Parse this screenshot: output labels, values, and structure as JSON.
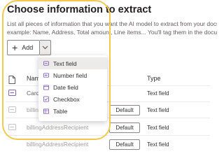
{
  "page": {
    "title": "Choose information to extract",
    "description_line1": "List all pieces of information that you want the AI model to extract from your documents. For",
    "description_line2": "example: Name, Address, Total amount, Line items... You'll tag them in the documents."
  },
  "toolbar": {
    "add_label": "Add",
    "add_icon": "plus-icon",
    "dropdown_icon": "chevron-down-icon"
  },
  "menu": {
    "items": [
      {
        "label": "Text field",
        "icon": "text-field-icon"
      },
      {
        "label": "Number field",
        "icon": "number-field-icon"
      },
      {
        "label": "Date field",
        "icon": "date-field-icon"
      },
      {
        "label": "Checkbox",
        "icon": "checkbox-icon"
      },
      {
        "label": "Table",
        "icon": "table-icon"
      }
    ],
    "selected_index": 0
  },
  "table": {
    "header_name": "Name",
    "header_type": "Type",
    "rows": [
      {
        "name": "CardHolder",
        "type": "Text field"
      },
      {
        "name": "billingAddressRecipient",
        "default_label": "Default",
        "type": "Text field"
      },
      {
        "name": "billingAddressRecipient",
        "default_label": "Default",
        "type": "Text field"
      },
      {
        "name": "billingAddressRecipient",
        "default_label": "Default",
        "type": "Text field"
      }
    ]
  },
  "colors": {
    "accent": "#8764b8",
    "highlight": "#f2c94c"
  }
}
